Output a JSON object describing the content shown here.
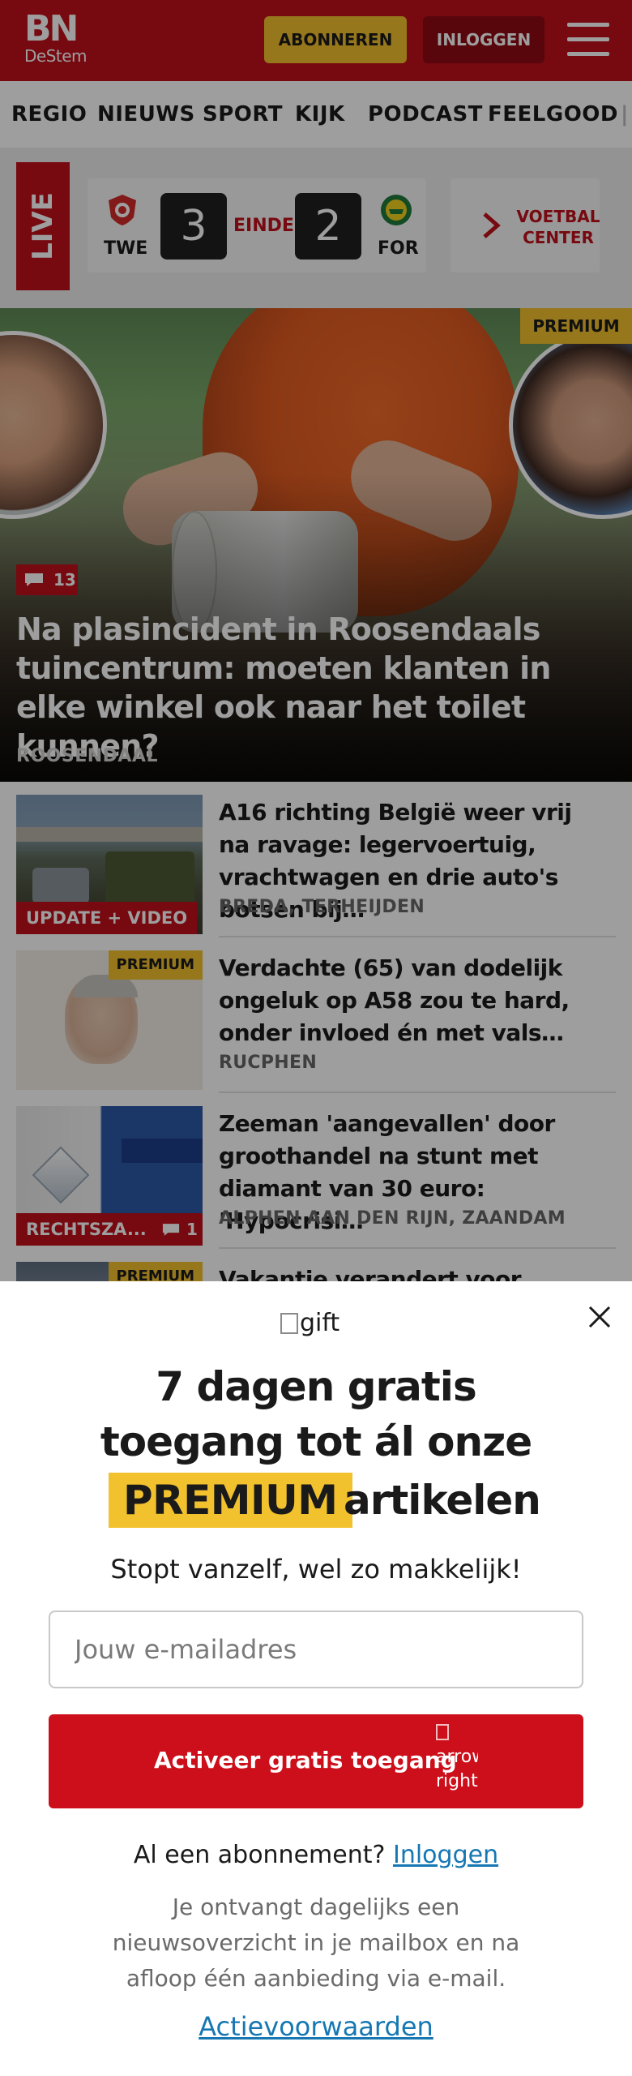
{
  "header": {
    "logo_main": "BN",
    "logo_sub": "DeStem",
    "subscribe_label": "ABONNEREN",
    "login_label": "INLOGGEN",
    "colors": {
      "brand_red": "#c0101a",
      "accent_yellow": "#f2c12e",
      "login_bg": "#8e0a12"
    }
  },
  "nav": {
    "items": [
      "REGIO",
      "NIEUWS",
      "SPORT",
      "KIJK",
      "PODCAST",
      "FEELGOOD"
    ]
  },
  "live": {
    "tag": "LIVE",
    "home_team": "TWE",
    "home_score": "3",
    "status": "EINDE",
    "away_score": "2",
    "away_team": "FOR",
    "voetbal_center_line1": "VOETBAL",
    "voetbal_center_line2": "CENTER"
  },
  "hero": {
    "premium_label": "PREMIUM",
    "comment_count": "13",
    "title": "Na plasincident in Roosendaals tuincentrum: moeten klanten in elke winkel ook naar het toilet kunnen?",
    "location": "ROOSENDAAL"
  },
  "articles": [
    {
      "title": "A16 richting België weer vrij na ravage: legervoertuig, vrachtwa­gen en drie auto's botsen bij…",
      "location": "BREDA, TERHEIJDEN",
      "label": "UPDATE + VIDEO"
    },
    {
      "title": "Verdachte (65) van dodelijk ongeluk op A58 zou te hard, onder invloed én met vals…",
      "location": "RUCPHEN",
      "premium_label": "PREMIUM"
    },
    {
      "title": "Zeeman 'aangevallen' door groothandel na stunt met diamant van 30 euro: 'Hypocrisi…",
      "location": "ALPHEN AAN DEN RIJN, ZAANDAM",
      "label": "RECHTSZA...",
      "comment_count": "1"
    },
    {
      "title": "Vakantie verandert voor…",
      "premium_label": "PREMIUM"
    }
  ],
  "modal": {
    "gift_alt": "gift",
    "headline_line1": "7 dagen gratis",
    "headline_line2": "toegang tot ál onze",
    "headline_premium": "PREMIUM",
    "headline_articles": "artikelen",
    "subtitle": "Stopt vanzelf, wel zo makkelijk!",
    "email_placeholder": "Jouw e-mailadres",
    "cta_label": "Activeer gratis toegang",
    "cta_arrow_alt": "arrow-right",
    "login_prompt": "Al een abonnement?",
    "login_link": "Inloggen",
    "fine_print": "Je ontvangt dagelijks een nieuwsoverzicht in je mailbox en na afloop één aanbieding via e-mail.",
    "terms_link": "Actievoorwaarden"
  }
}
